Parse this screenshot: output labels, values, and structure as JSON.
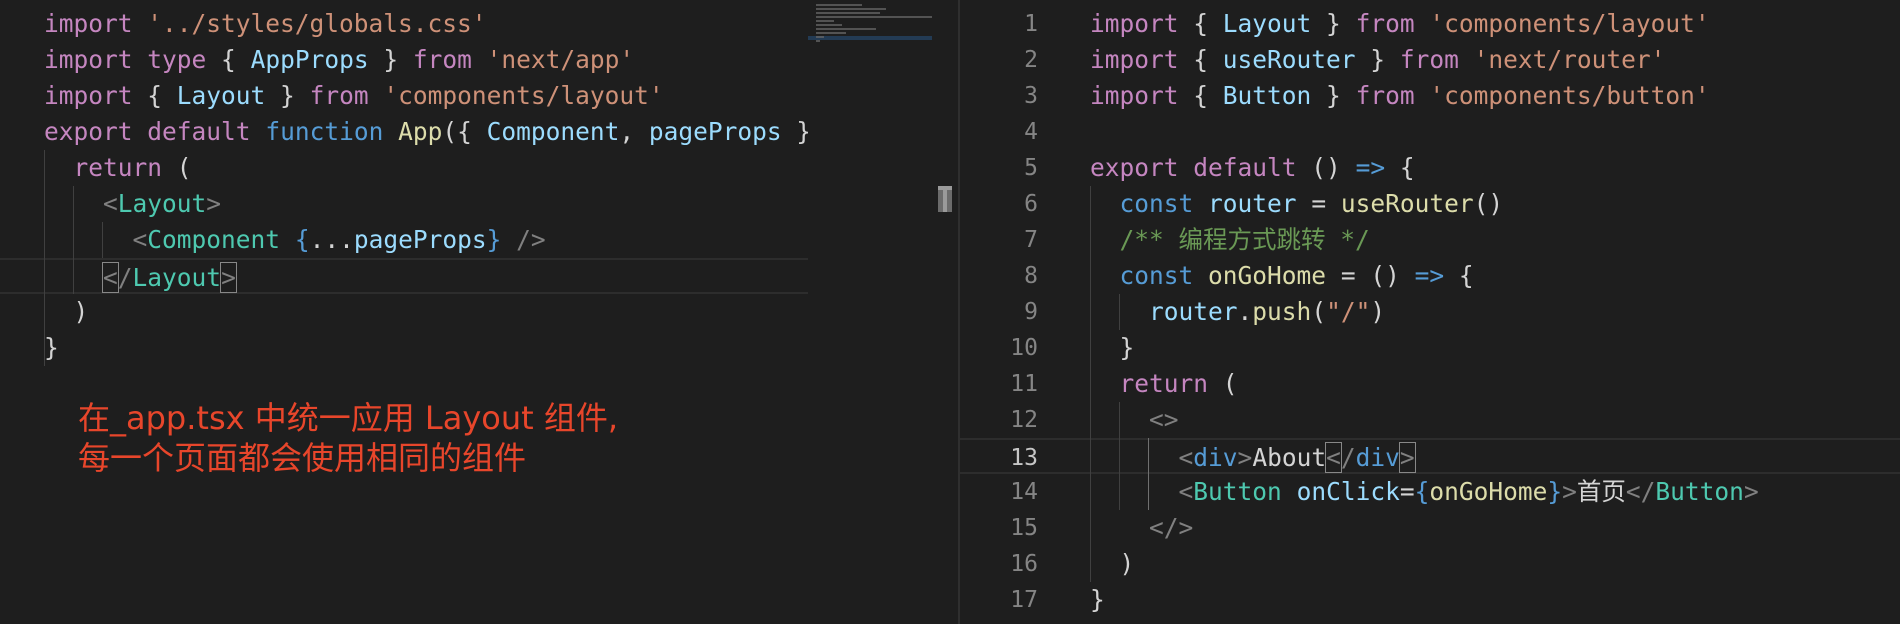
{
  "left_editor": {
    "lines": [
      [
        {
          "t": "import",
          "c": "kw"
        },
        {
          "t": " ",
          "c": "pu"
        },
        {
          "t": "'../styles/globals.css'",
          "c": "st"
        }
      ],
      [
        {
          "t": "import",
          "c": "kw"
        },
        {
          "t": " ",
          "c": "pu"
        },
        {
          "t": "type",
          "c": "kw"
        },
        {
          "t": " { ",
          "c": "pu"
        },
        {
          "t": "AppProps",
          "c": "va"
        },
        {
          "t": " } ",
          "c": "pu"
        },
        {
          "t": "from",
          "c": "kw"
        },
        {
          "t": " ",
          "c": "pu"
        },
        {
          "t": "'next/app'",
          "c": "st"
        }
      ],
      [
        {
          "t": "import",
          "c": "kw"
        },
        {
          "t": " { ",
          "c": "pu"
        },
        {
          "t": "Layout",
          "c": "va"
        },
        {
          "t": " } ",
          "c": "pu"
        },
        {
          "t": "from",
          "c": "kw"
        },
        {
          "t": " ",
          "c": "pu"
        },
        {
          "t": "'components/layout'",
          "c": "st"
        }
      ],
      [
        {
          "t": "export",
          "c": "kw"
        },
        {
          "t": " ",
          "c": "pu"
        },
        {
          "t": "default",
          "c": "kw"
        },
        {
          "t": " ",
          "c": "pu"
        },
        {
          "t": "function",
          "c": "kb"
        },
        {
          "t": " ",
          "c": "pu"
        },
        {
          "t": "App",
          "c": "fn"
        },
        {
          "t": "({ ",
          "c": "pu"
        },
        {
          "t": "Component",
          "c": "va"
        },
        {
          "t": ", ",
          "c": "pu"
        },
        {
          "t": "pageProps",
          "c": "va"
        },
        {
          "t": " }:",
          "c": "pu"
        }
      ],
      [
        {
          "t": "  ",
          "c": "pu"
        },
        {
          "t": "return",
          "c": "kw"
        },
        {
          "t": " (",
          "c": "pu"
        }
      ],
      [
        {
          "t": "    ",
          "c": "pu"
        },
        {
          "t": "<",
          "c": "tg"
        },
        {
          "t": "Layout",
          "c": "ty"
        },
        {
          "t": ">",
          "c": "tg"
        }
      ],
      [
        {
          "t": "      ",
          "c": "pu"
        },
        {
          "t": "<",
          "c": "tg"
        },
        {
          "t": "Component",
          "c": "ty"
        },
        {
          "t": " ",
          "c": "pu"
        },
        {
          "t": "{",
          "c": "bb"
        },
        {
          "t": "...",
          "c": "pu"
        },
        {
          "t": "pageProps",
          "c": "va"
        },
        {
          "t": "}",
          "c": "bb"
        },
        {
          "t": " />",
          "c": "tg"
        }
      ],
      [
        {
          "t": "    ",
          "c": "pu"
        },
        {
          "t": "<",
          "c": "tg",
          "box": true
        },
        {
          "t": "/",
          "c": "tg"
        },
        {
          "t": "Layout",
          "c": "ty"
        },
        {
          "t": ">",
          "c": "tg",
          "box": true
        }
      ],
      [
        {
          "t": "  )",
          "c": "pu"
        }
      ],
      [
        {
          "t": "}",
          "c": "pu"
        }
      ]
    ]
  },
  "annotation": {
    "line1": "在_app.tsx 中统一应用 Layout 组件,",
    "line2": "每一个页面都会使用相同的组件"
  },
  "right_editor": {
    "active_line": 13,
    "line_numbers": [
      "1",
      "2",
      "3",
      "4",
      "5",
      "6",
      "7",
      "8",
      "9",
      "10",
      "11",
      "12",
      "13",
      "14",
      "15",
      "16",
      "17"
    ],
    "lines": [
      [
        {
          "t": "import",
          "c": "kw"
        },
        {
          "t": " { ",
          "c": "pu"
        },
        {
          "t": "Layout",
          "c": "va"
        },
        {
          "t": " } ",
          "c": "pu"
        },
        {
          "t": "from",
          "c": "kw"
        },
        {
          "t": " ",
          "c": "pu"
        },
        {
          "t": "'components/layout'",
          "c": "st"
        }
      ],
      [
        {
          "t": "import",
          "c": "kw"
        },
        {
          "t": " { ",
          "c": "pu"
        },
        {
          "t": "useRouter",
          "c": "va"
        },
        {
          "t": " } ",
          "c": "pu"
        },
        {
          "t": "from",
          "c": "kw"
        },
        {
          "t": " ",
          "c": "pu"
        },
        {
          "t": "'next/router'",
          "c": "st"
        }
      ],
      [
        {
          "t": "import",
          "c": "kw"
        },
        {
          "t": " { ",
          "c": "pu"
        },
        {
          "t": "Button",
          "c": "va"
        },
        {
          "t": " } ",
          "c": "pu"
        },
        {
          "t": "from",
          "c": "kw"
        },
        {
          "t": " ",
          "c": "pu"
        },
        {
          "t": "'components/button'",
          "c": "st"
        }
      ],
      [],
      [
        {
          "t": "export",
          "c": "kw"
        },
        {
          "t": " ",
          "c": "pu"
        },
        {
          "t": "default",
          "c": "kw"
        },
        {
          "t": " () ",
          "c": "pu"
        },
        {
          "t": "=>",
          "c": "kb"
        },
        {
          "t": " {",
          "c": "pu"
        }
      ],
      [
        {
          "t": "  ",
          "c": "pu"
        },
        {
          "t": "const",
          "c": "kb"
        },
        {
          "t": " ",
          "c": "pu"
        },
        {
          "t": "router",
          "c": "va"
        },
        {
          "t": " = ",
          "c": "pu"
        },
        {
          "t": "useRouter",
          "c": "fn"
        },
        {
          "t": "()",
          "c": "pu"
        }
      ],
      [
        {
          "t": "  ",
          "c": "pu"
        },
        {
          "t": "/** 编程方式跳转 */",
          "c": "cm"
        }
      ],
      [
        {
          "t": "  ",
          "c": "pu"
        },
        {
          "t": "const",
          "c": "kb"
        },
        {
          "t": " ",
          "c": "pu"
        },
        {
          "t": "onGoHome",
          "c": "fn"
        },
        {
          "t": " = () ",
          "c": "pu"
        },
        {
          "t": "=>",
          "c": "kb"
        },
        {
          "t": " {",
          "c": "pu"
        }
      ],
      [
        {
          "t": "    ",
          "c": "pu"
        },
        {
          "t": "router",
          "c": "va"
        },
        {
          "t": ".",
          "c": "pu"
        },
        {
          "t": "push",
          "c": "fn"
        },
        {
          "t": "(",
          "c": "pu"
        },
        {
          "t": "\"/\"",
          "c": "st"
        },
        {
          "t": ")",
          "c": "pu"
        }
      ],
      [
        {
          "t": "  }",
          "c": "pu"
        }
      ],
      [
        {
          "t": "  ",
          "c": "pu"
        },
        {
          "t": "return",
          "c": "kw"
        },
        {
          "t": " (",
          "c": "pu"
        }
      ],
      [
        {
          "t": "    ",
          "c": "pu"
        },
        {
          "t": "<>",
          "c": "tg"
        }
      ],
      [
        {
          "t": "      ",
          "c": "pu"
        },
        {
          "t": "<",
          "c": "tg"
        },
        {
          "t": "div",
          "c": "kb"
        },
        {
          "t": ">",
          "c": "tg"
        },
        {
          "t": "About",
          "c": "plain"
        },
        {
          "t": "<",
          "c": "tg",
          "box": true
        },
        {
          "t": "/",
          "c": "tg"
        },
        {
          "t": "div",
          "c": "kb"
        },
        {
          "t": ">",
          "c": "tg",
          "box": true
        }
      ],
      [
        {
          "t": "      ",
          "c": "pu"
        },
        {
          "t": "<",
          "c": "tg"
        },
        {
          "t": "Button",
          "c": "ty"
        },
        {
          "t": " ",
          "c": "pu"
        },
        {
          "t": "onClick",
          "c": "va"
        },
        {
          "t": "=",
          "c": "pu"
        },
        {
          "t": "{",
          "c": "bb"
        },
        {
          "t": "onGoHome",
          "c": "fn"
        },
        {
          "t": "}",
          "c": "bb"
        },
        {
          "t": ">",
          "c": "tg"
        },
        {
          "t": "首页",
          "c": "plain"
        },
        {
          "t": "</",
          "c": "tg"
        },
        {
          "t": "Button",
          "c": "ty"
        },
        {
          "t": ">",
          "c": "tg"
        }
      ],
      [
        {
          "t": "    ",
          "c": "pu"
        },
        {
          "t": "</>",
          "c": "tg"
        }
      ],
      [
        {
          "t": "  )",
          "c": "pu"
        }
      ],
      [
        {
          "t": "}",
          "c": "pu"
        }
      ]
    ]
  }
}
